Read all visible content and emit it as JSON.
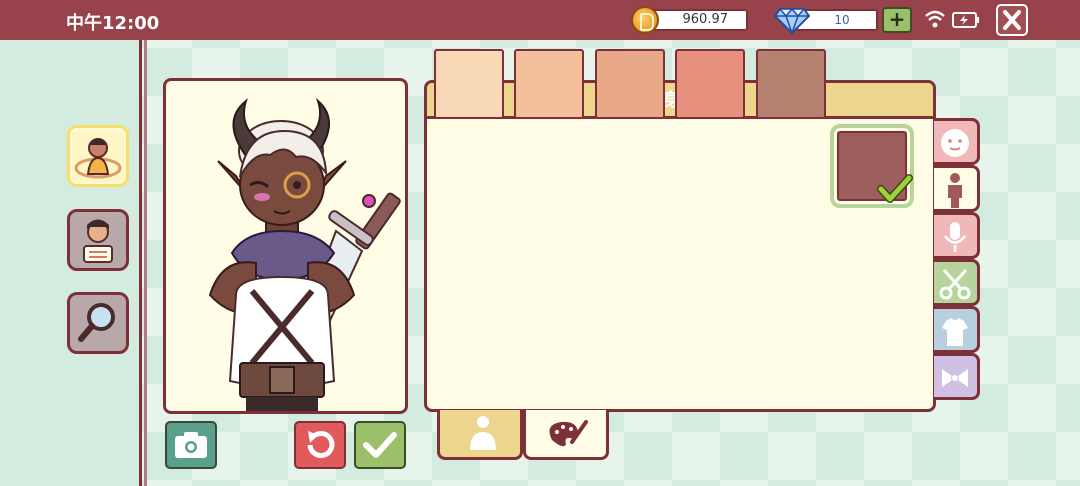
{
  "status_bar": {
    "time": "中午12:00",
    "coins": "960.97",
    "gems": "10",
    "add_label": "+",
    "icons": [
      "coin-icon",
      "gem-icon",
      "wifi-icon",
      "battery-icon",
      "close-icon"
    ]
  },
  "left_nav": {
    "items": [
      {
        "name": "character-body-nav",
        "icon": "character-avatar-icon",
        "active": true
      },
      {
        "name": "character-profile-nav",
        "icon": "character-scroll-icon",
        "active": false
      },
      {
        "name": "search-nav",
        "icon": "magnifier-icon",
        "active": false
      }
    ]
  },
  "panel": {
    "title": "身体",
    "swatches": [
      "#f9d8b8",
      "#f4c09c",
      "#e9a888",
      "#e8907e",
      "#b68270",
      "#9e5e5e"
    ],
    "selected_index": 5
  },
  "side_tabs": [
    {
      "icon": "face-icon",
      "bg": "#f0b8b8"
    },
    {
      "icon": "body-icon",
      "bg": "#fffde6",
      "active": true
    },
    {
      "icon": "microphone-icon",
      "bg": "#f0b8b8"
    },
    {
      "icon": "scissors-icon",
      "bg": "#b6d49c"
    },
    {
      "icon": "shirt-icon",
      "bg": "#b8cfe0"
    },
    {
      "icon": "bow-icon",
      "bg": "#cfc0e4"
    }
  ],
  "bottom_tabs": [
    {
      "icon": "person-silhouette-icon",
      "active": false
    },
    {
      "icon": "palette-icon",
      "active": true
    }
  ],
  "actions": {
    "icons": [
      "camera-icon",
      "undo-icon",
      "confirm-check-icon"
    ],
    "colors": {
      "camera": "#5aa08c",
      "undo": "#e15a5c",
      "confirm": "#9cbf6a"
    }
  },
  "theme": {
    "frame": "#7d3038",
    "topbar": "#98434b",
    "panel_bg": "#fffde6",
    "header_bg": "#ecd58c"
  }
}
